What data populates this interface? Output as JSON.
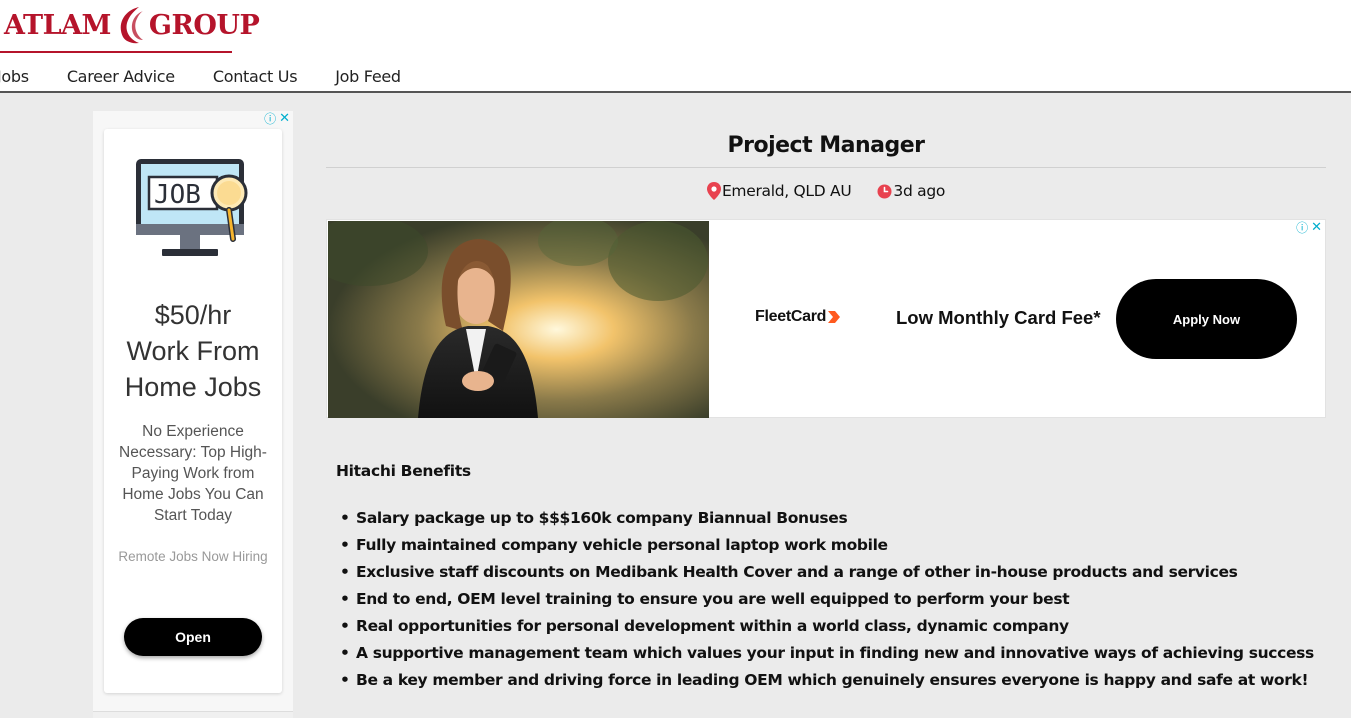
{
  "brand": {
    "logo_left": "ATLAM",
    "logo_right": "GROUP",
    "accent_color": "#b5142b"
  },
  "nav": {
    "items": [
      {
        "label": "Jobs"
      },
      {
        "label": "Career Advice"
      },
      {
        "label": "Contact Us"
      },
      {
        "label": "Job Feed"
      }
    ]
  },
  "left_ad": {
    "illustration_text": "JOB",
    "headline_line1": "$50/hr",
    "headline_line2": "Work From",
    "headline_line3": "Home Jobs",
    "body": "No Experience Necessary: Top High-Paying Work from Home Jobs You Can Start Today",
    "source": "Remote Jobs Now Hiring",
    "cta": "Open",
    "info_icon": "info-icon",
    "close_icon": "close-icon"
  },
  "job": {
    "title": "Project Manager",
    "location": "Emerald, QLD AU",
    "posted": "3d ago",
    "meta_icon_color": "#e8424f"
  },
  "banner_ad": {
    "logo_text": "FleetCard",
    "logo_accent": "#ff5a1f",
    "tagline": "Low Monthly Card Fee*",
    "cta": "Apply Now"
  },
  "content": {
    "heading": "Hitachi Benefits",
    "benefits": [
      "Salary package up to $$$160k company Biannual Bonuses",
      "Fully maintained company vehicle personal laptop work mobile",
      "Exclusive staff discounts on Medibank Health Cover and a range of other in-house products and services",
      "End to end, OEM level training to ensure you are well equipped to perform your best",
      "Real opportunities for personal development within a world class, dynamic company",
      "A supportive management team which values your input in finding new and innovative ways of achieving success",
      "Be a key member and driving force in leading OEM which genuinely ensures everyone is happy and safe at work!"
    ]
  }
}
